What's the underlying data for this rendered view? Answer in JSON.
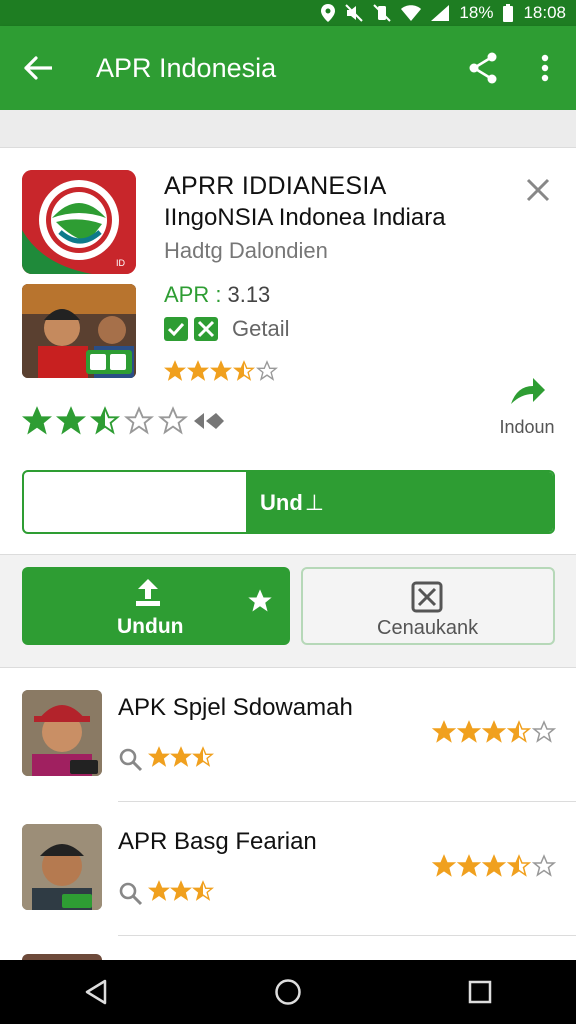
{
  "status_bar": {
    "battery": "18%",
    "time": "18:08"
  },
  "app_bar": {
    "title": "APR Indonesia",
    "icons": [
      "back-arrow-icon",
      "share-icon",
      "more-vert-icon"
    ]
  },
  "app": {
    "name": "APRR IDDIANESIA",
    "subtitle": "IIngoNSIA  Indonea Indiara",
    "developer": "Hadtg Dalondien",
    "version_label": "APR :",
    "version": "3.13",
    "detail_label": "Getail",
    "small_rating": 3.5,
    "big_rating": 2.5,
    "install_label": "Indoun",
    "download_label": "Und",
    "download_progress_percent": 42
  },
  "actions": {
    "primary_label": "Undun",
    "secondary_label": "Cenaukank"
  },
  "list": [
    {
      "name": "APK Spjel Sdowamah",
      "rating": 3.5,
      "meta_rating": 2.5
    },
    {
      "name": "APR Basg Fearian",
      "rating": 3.5,
      "meta_rating": 2.5
    }
  ],
  "colors": {
    "brand_green": "#2e9d33",
    "dark_green": "#1e7d22",
    "star_orange": "#f0a01e"
  }
}
